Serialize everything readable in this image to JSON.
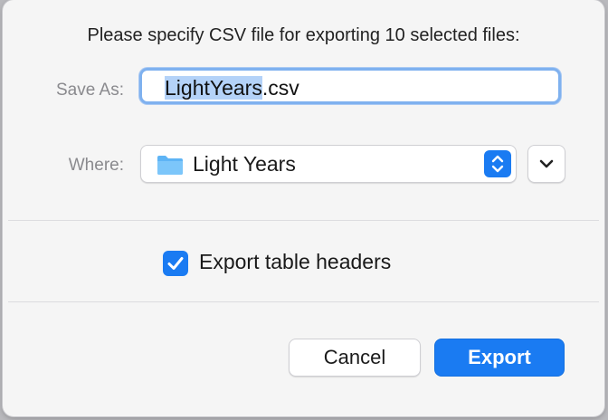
{
  "dialog": {
    "message": "Please specify CSV file for exporting 10 selected files:",
    "save_as": {
      "label": "Save As:",
      "value_selected": "LightYears",
      "value_rest": ".csv"
    },
    "where": {
      "label": "Where:",
      "value": "Light Years",
      "icon": "folder-icon"
    },
    "options": {
      "export_headers_label": "Export table headers",
      "export_headers_checked": true
    },
    "buttons": {
      "cancel_label": "Cancel",
      "export_label": "Export"
    }
  },
  "colors": {
    "accent": "#1a7bf2",
    "selection": "#b4d2f8",
    "focus_ring": "#7fb1ef"
  }
}
